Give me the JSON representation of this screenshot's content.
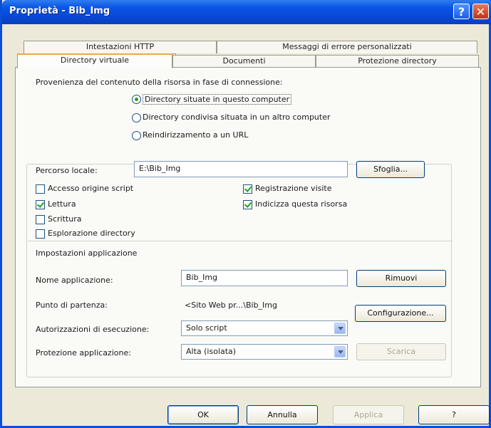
{
  "window": {
    "title": "Proprietà - Bib_Img",
    "help_glyph": "?",
    "close_glyph": "✕"
  },
  "tabs": {
    "row_back": [
      "Intestazioni HTTP",
      "Messaggi di errore personalizzati"
    ],
    "row_front": [
      "Directory virtuale",
      "Documenti",
      "Protezione directory"
    ]
  },
  "source": {
    "label": "Provenienza del contenuto della risorsa in fase di connessione:",
    "options": [
      {
        "label": "Directory situate in questo computer",
        "selected": true
      },
      {
        "label": "Directory condivisa situata in un altro computer",
        "selected": false
      },
      {
        "label": "Reindirizzamento a un URL",
        "selected": false
      }
    ]
  },
  "local_path": {
    "label": "Percorso locale:",
    "value": "E:\\Bib_Img",
    "browse_button": "Sfoglia..."
  },
  "checks": [
    {
      "label": "Accesso origine script",
      "checked": false
    },
    {
      "label": "Lettura",
      "checked": true
    },
    {
      "label": "Scrittura",
      "checked": false
    },
    {
      "label": "Esplorazione directory",
      "checked": false
    },
    {
      "label": "Registrazione visite",
      "checked": true
    },
    {
      "label": "Indicizza questa risorsa",
      "checked": true
    }
  ],
  "app_settings": {
    "heading": "Impostazioni applicazione",
    "name_label": "Nome applicazione:",
    "name_value": "Bib_Img",
    "remove_button": "Rimuovi",
    "start_label": "Punto di partenza:",
    "start_value": "<Sito Web pr...\\Bib_Img",
    "config_button": "Configurazione...",
    "exec_label": "Autorizzazioni di esecuzione:",
    "exec_value": "Solo script",
    "protect_label": "Protezione applicazione:",
    "protect_value": "Alta (isolata)",
    "unload_button": "Scarica"
  },
  "footer": {
    "ok": "OK",
    "cancel": "Annulla",
    "apply": "Applica",
    "help": "?"
  },
  "colors": {
    "title_bar": "#0a56e6",
    "panel": "#ece9d8",
    "check_mark": "#21a121"
  }
}
